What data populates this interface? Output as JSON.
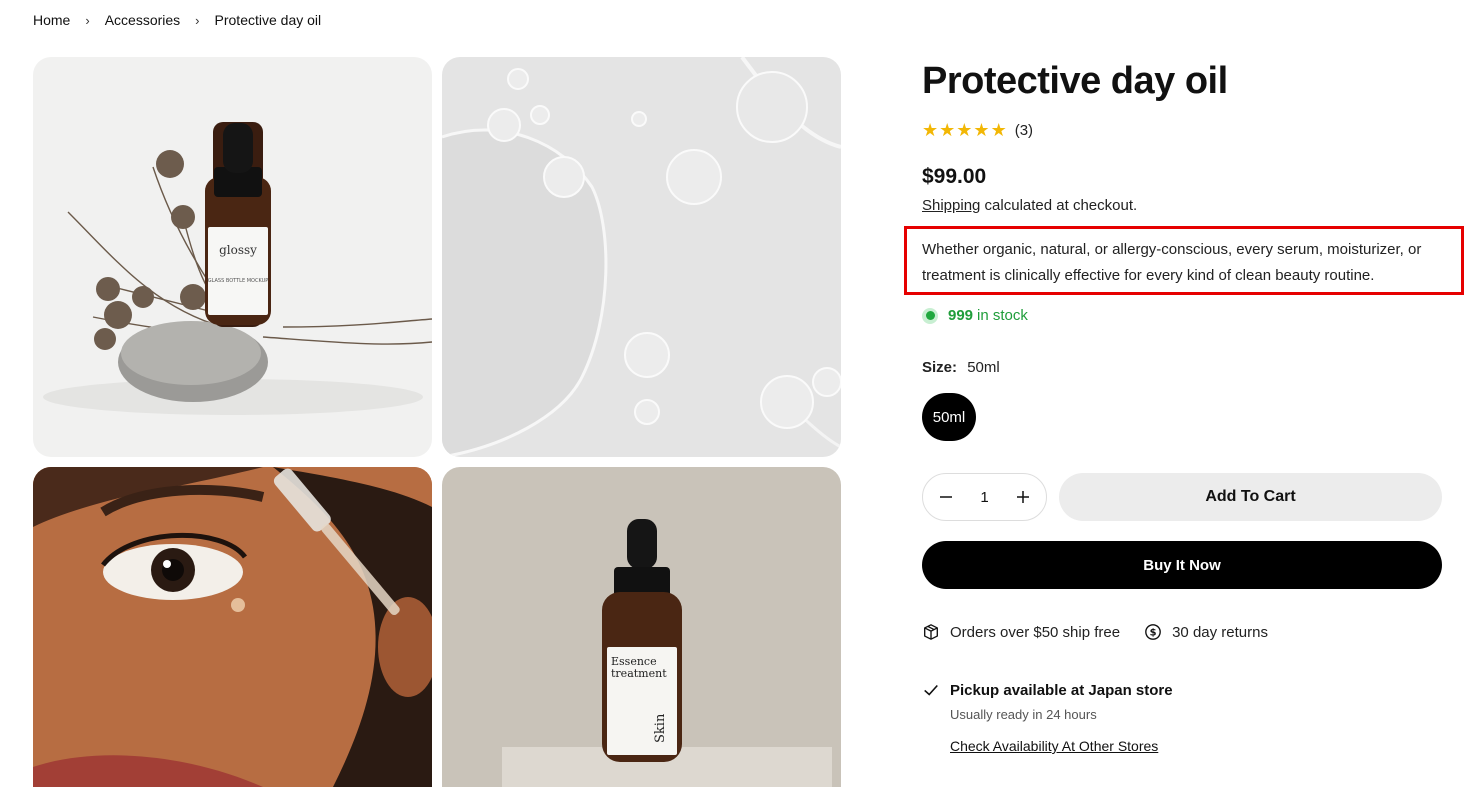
{
  "breadcrumb": {
    "items": [
      "Home",
      "Accessories",
      "Protective day oil"
    ]
  },
  "product": {
    "title": "Protective day oil",
    "rating_count": "(3)",
    "stars": 5,
    "price": "$99.00",
    "shipping_link": "Shipping",
    "shipping_rest": " calculated at checkout.",
    "description": "Whether organic, natural, or allergy-conscious, every serum, moisturizer, or treatment is clinically effective for every kind of clean beauty routine.",
    "stock_count": "999",
    "stock_text": "in stock",
    "size_label": "Size:",
    "size_value": "50ml",
    "size_option": "50ml",
    "quantity": "1",
    "add_to_cart": "Add To Cart",
    "buy_now": "Buy It Now"
  },
  "perks": {
    "ship": "Orders over $50 ship free",
    "returns": "30 day returns"
  },
  "pickup": {
    "title": "Pickup available at Japan store",
    "subtitle": "Usually ready in 24 hours",
    "link": "Check Availability At Other Stores"
  },
  "images": {
    "bottle_label": "glossy",
    "bottle_label_sub": "GLASS BOTTLE MOCKUP",
    "bottle2_label_a": "Essence",
    "bottle2_label_b": "treatment",
    "bottle2_brand": "Skin"
  },
  "colors": {
    "accent_red": "#e60000",
    "stock_green": "#1f9d3a",
    "star": "#f2b705"
  }
}
